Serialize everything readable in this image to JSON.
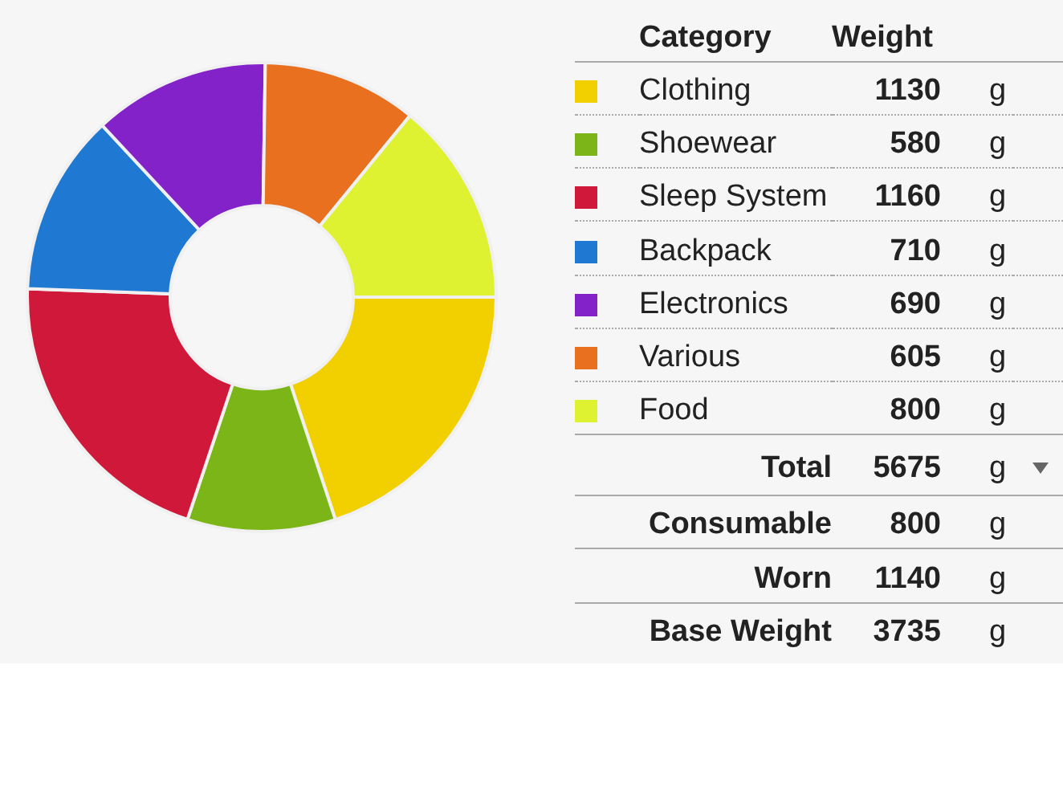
{
  "table": {
    "columns": [
      "Category",
      "Weight"
    ],
    "rows": [
      {
        "category": "Clothing",
        "weight": "1130",
        "unit": "g",
        "color": "#f2d000"
      },
      {
        "category": "Shoewear",
        "weight": "580",
        "unit": "g",
        "color": "#7cb518"
      },
      {
        "category": "Sleep System",
        "weight": "1160",
        "unit": "g",
        "color": "#d0193a"
      },
      {
        "category": "Backpack",
        "weight": "710",
        "unit": "g",
        "color": "#1f78d1"
      },
      {
        "category": "Electronics",
        "weight": "690",
        "unit": "g",
        "color": "#8222c8"
      },
      {
        "category": "Various",
        "weight": "605",
        "unit": "g",
        "color": "#e8701e"
      },
      {
        "category": "Food",
        "weight": "800",
        "unit": "g",
        "color": "#dff232"
      }
    ],
    "summary": [
      {
        "label": "Total",
        "weight": "5675",
        "unit": "g",
        "dropdown": true
      },
      {
        "label": "Consumable",
        "weight": "800",
        "unit": "g",
        "dropdown": false
      },
      {
        "label": "Worn",
        "weight": "1140",
        "unit": "g",
        "dropdown": false
      },
      {
        "label": "Base Weight",
        "weight": "3735",
        "unit": "g",
        "dropdown": false
      }
    ]
  }
}
